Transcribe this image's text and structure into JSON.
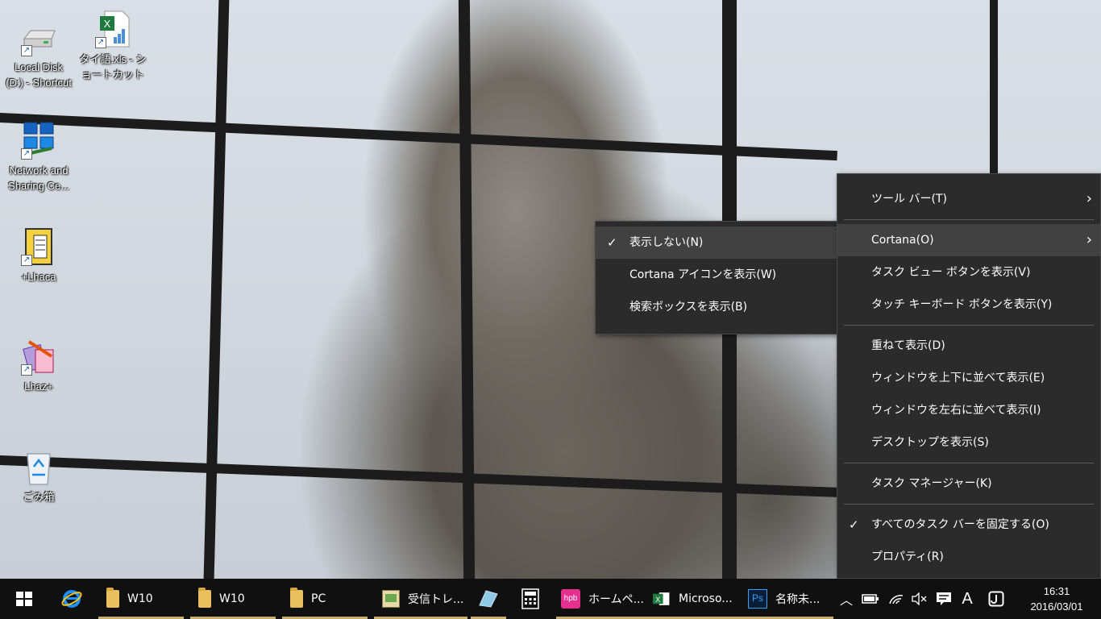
{
  "desktop_icons": [
    {
      "name": "local-disk-shortcut",
      "label_line1": "Local Disk",
      "label_line2": "(D:) - Shortcut"
    },
    {
      "name": "thai-xls-shortcut",
      "label_line1": "タイ語.xls - シ",
      "label_line2": "ョートカット"
    },
    {
      "name": "network-sharing-center",
      "label_line1": "Network and",
      "label_line2": "Sharing Ce..."
    },
    {
      "name": "lhaca",
      "label_line1": "+Lhaca",
      "label_line2": ""
    },
    {
      "name": "lhaz",
      "label_line1": "Lhaz+",
      "label_line2": ""
    },
    {
      "name": "recycle-bin",
      "label_line1": "ごみ箱",
      "label_line2": ""
    }
  ],
  "cortana_submenu": {
    "items": [
      {
        "label": "表示しない(N)",
        "checked": true,
        "highlighted": true
      },
      {
        "label": "Cortana アイコンを表示(W)",
        "checked": false
      },
      {
        "label": "検索ボックスを表示(B)",
        "checked": false
      }
    ]
  },
  "taskbar_menu": {
    "check_mark": "✓",
    "submenu_arrow": "›",
    "toolbar": "ツール バー(T)",
    "cortana": "Cortana(O)",
    "task_view": "タスク ビュー ボタンを表示(V)",
    "touch_keyboard": "タッチ キーボード ボタンを表示(Y)",
    "cascade": "重ねて表示(D)",
    "stack": "ウィンドウを上下に並べて表示(E)",
    "side_by_side": "ウィンドウを左右に並べて表示(I)",
    "show_desktop": "デスクトップを表示(S)",
    "task_manager": "タスク マネージャー(K)",
    "lock_taskbars": "すべてのタスク バーを固定する(O)",
    "properties": "プロパティ(R)"
  },
  "taskbar": {
    "apps": [
      {
        "name": "ie",
        "label": ""
      },
      {
        "name": "folder-w10-a",
        "label": "W10"
      },
      {
        "name": "folder-w10-b",
        "label": "W10"
      },
      {
        "name": "folder-pc",
        "label": "PC"
      },
      {
        "name": "mail-inbox",
        "label": "受信トレ..."
      },
      {
        "name": "app-blue",
        "label": ""
      },
      {
        "name": "calculator",
        "label": ""
      },
      {
        "name": "homepage-builder",
        "label": "ホームペ...",
        "icon_text": "hpb"
      },
      {
        "name": "excel",
        "label": "Microso..."
      },
      {
        "name": "photoshop",
        "label": "名称未...",
        "icon_text": "Ps"
      }
    ],
    "tray": {
      "chevron": "︿",
      "ime": "A",
      "time": "16:31",
      "date": "2016/03/01"
    }
  },
  "colors": {
    "menu_bg": "#2b2b2b",
    "menu_highlight": "#414141",
    "taskbar_bg": "#101010",
    "active_underline": "#c7ad6e"
  }
}
